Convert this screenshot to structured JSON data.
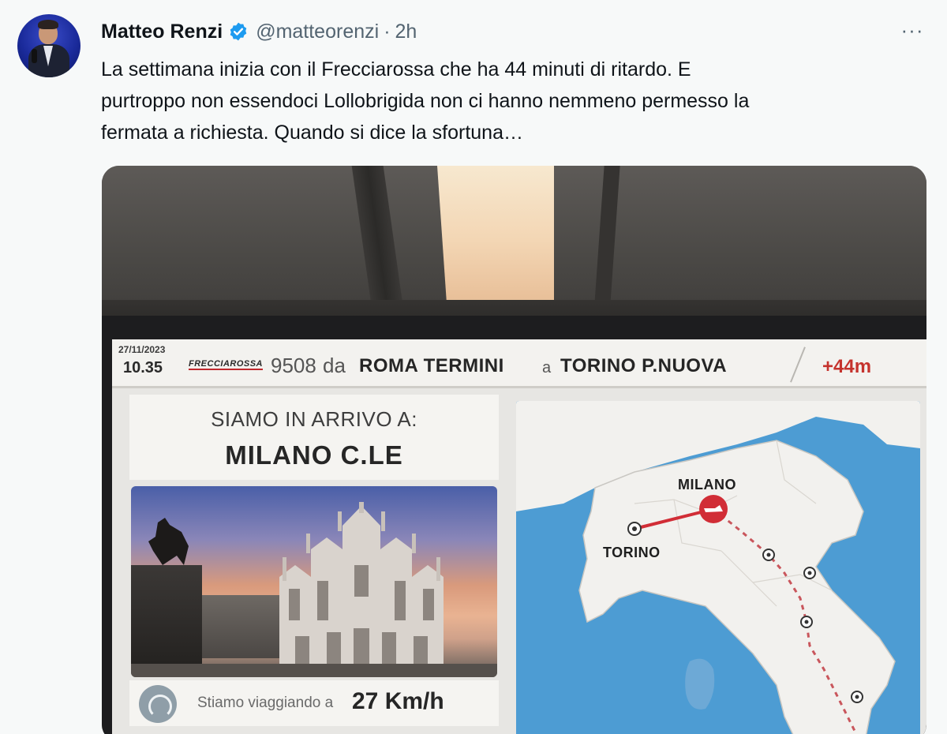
{
  "author": {
    "name": "Matteo Renzi",
    "handle": "@matteorenzi",
    "separator": "·",
    "time": "2h"
  },
  "tweet": {
    "text": "La settimana inizia con il Frecciarossa che ha 44 minuti di ritardo. E\npurtroppo non essendoci Lollobrigida non ci hanno nemmeno permesso la\nfermata a richiesta. Quando si dice la sfortuna…"
  },
  "more_menu": {
    "label": "···"
  },
  "board": {
    "date": "27/11/2023",
    "time": "10.35",
    "brand": "FRECCIAROSSA",
    "train_number": "9508",
    "from_word": "da",
    "from": "ROMA TERMINI",
    "to_word": "a",
    "to": "TORINO P.NUOVA",
    "delay": "+44m",
    "arrival_label": "SIAMO IN ARRIVO A:",
    "arrival_station": "MILANO C.LE",
    "speed_label": "Stiamo viaggiando a",
    "speed_value": "27 Km/h"
  },
  "map": {
    "cities": [
      "MILANO",
      "TORINO"
    ],
    "colors": {
      "sea": "#4d9cd3",
      "land": "#f2f1ee",
      "route": "#d12d36",
      "route_dashed": "#c9565c"
    }
  },
  "icons": [
    "verified-badge-icon",
    "more-options-icon",
    "speed-gauge-icon"
  ]
}
